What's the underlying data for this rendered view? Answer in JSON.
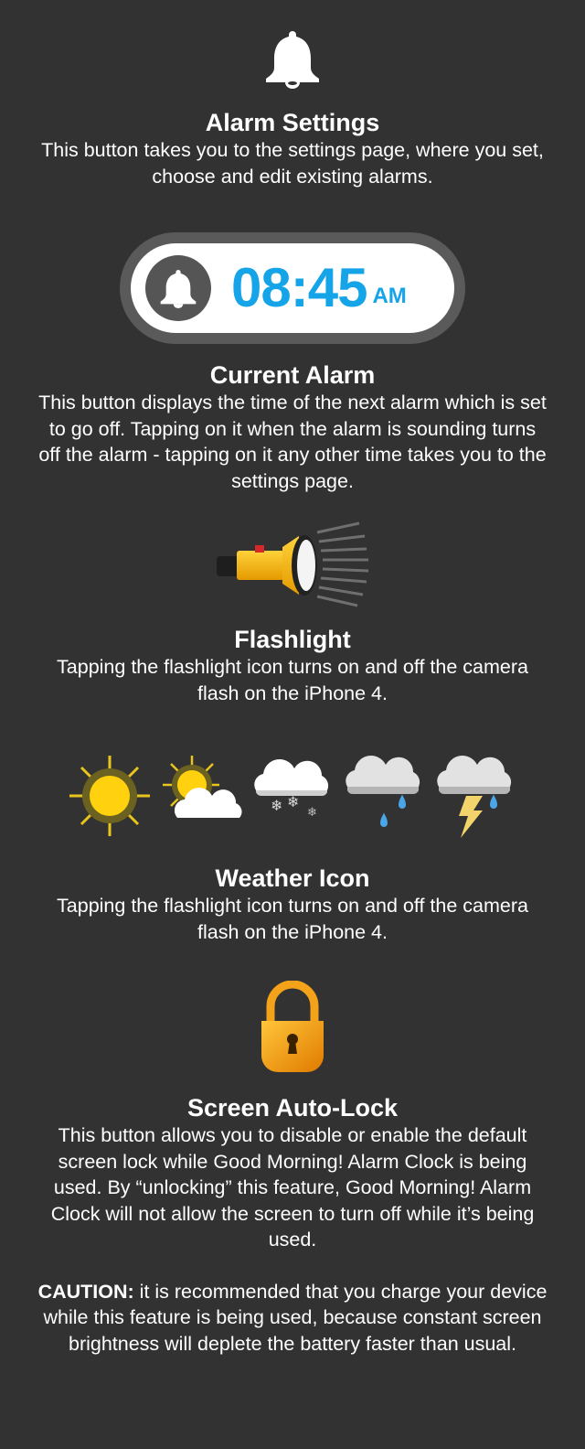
{
  "alarm_settings": {
    "icon": "bell-icon",
    "title": "Alarm Settings",
    "description": "This button takes you to the settings page, where you set, choose and edit existing alarms."
  },
  "current_alarm": {
    "icon": "bell-icon",
    "time": "08:45",
    "ampm": "AM",
    "time_color": "#15a4e8",
    "title": "Current Alarm",
    "description": "This button displays the time of the next alarm which is set to go off.  Tapping on it when the alarm is sounding turns off the alarm - tapping on it any other time takes you to the settings page."
  },
  "flashlight": {
    "icon": "flashlight-icon",
    "title": "Flashlight",
    "description": "Tapping the flashlight icon turns on and off the camera flash on the iPhone 4."
  },
  "weather": {
    "icons": [
      "sun-icon",
      "partly-cloudy-icon",
      "snow-icon",
      "rain-icon",
      "thunderstorm-icon"
    ],
    "title": "Weather Icon",
    "description": "Tapping the flashlight icon turns on and off the camera flash on the iPhone 4."
  },
  "auto_lock": {
    "icon": "padlock-icon",
    "title": "Screen Auto-Lock",
    "description": "This button allows you to disable or enable the default screen lock while Good Morning! Alarm Clock is being used.  By “unlocking” this feature, Good Morning! Alarm Clock will not allow the screen to turn off while it’s being used.",
    "caution_label": "CAUTION:",
    "caution_text": " it is recommended that you charge your device while this feature is being used, because constant screen brightness will deplete the battery faster than usual."
  }
}
